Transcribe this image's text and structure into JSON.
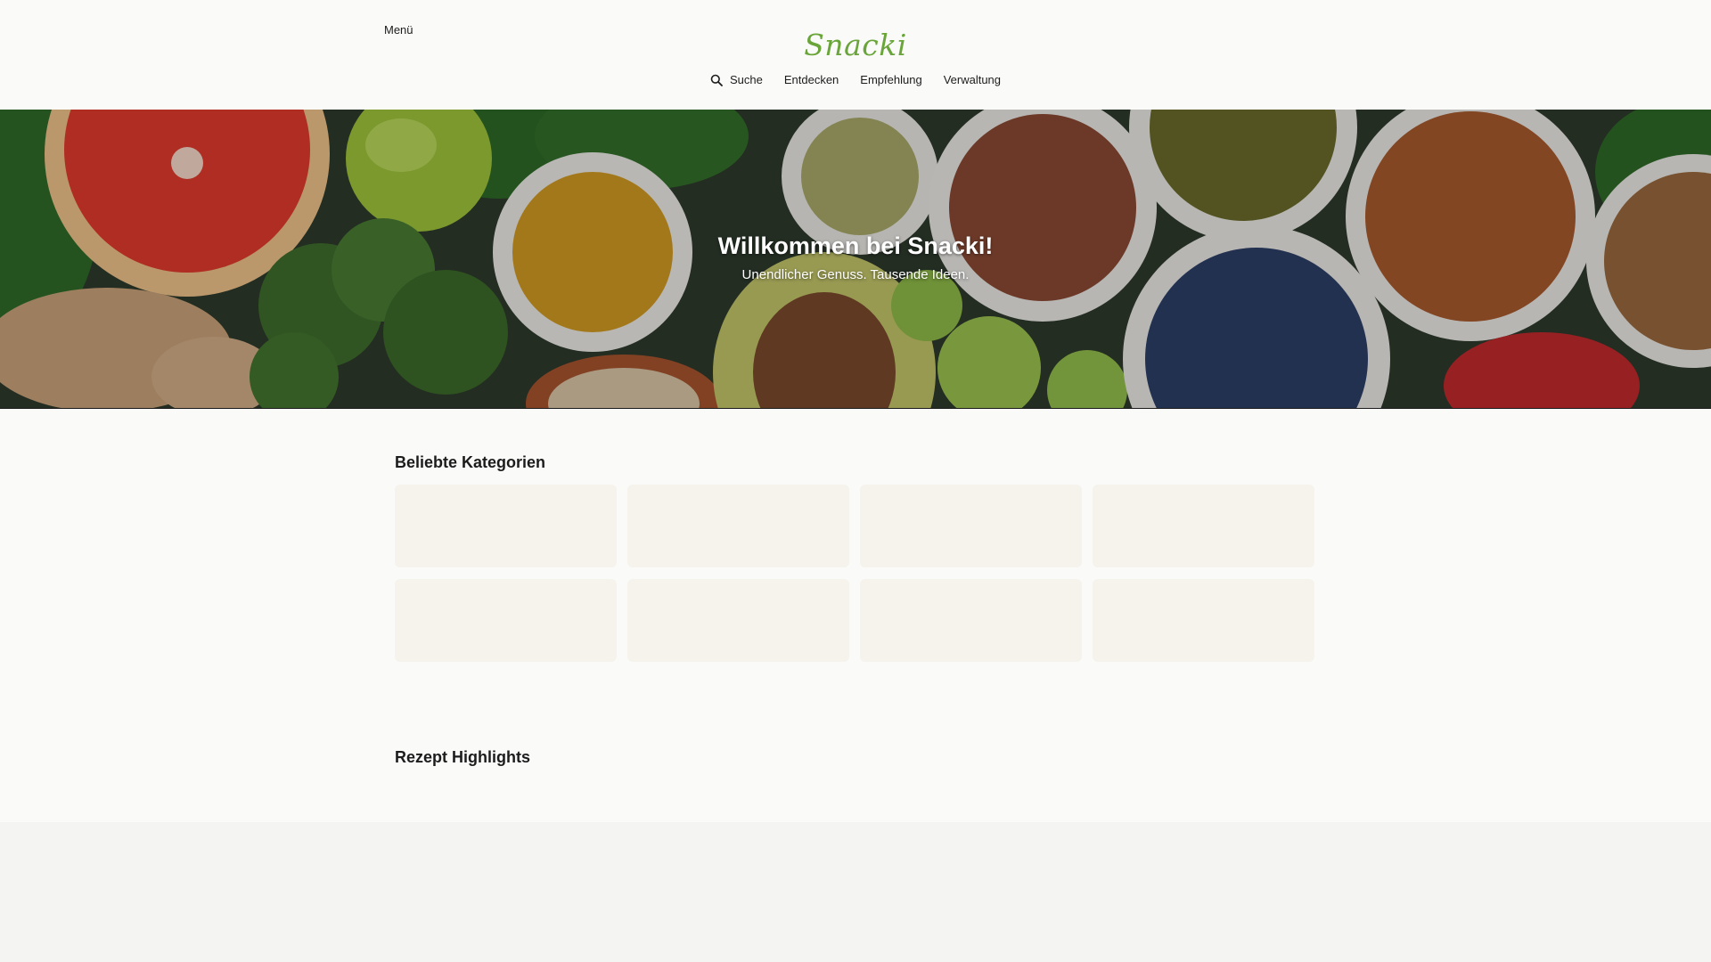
{
  "header": {
    "menu_label": "Menü",
    "brand": "Snacki",
    "brand_color": "#6aa53a",
    "nav": [
      {
        "label": "Suche",
        "icon": "search-icon"
      },
      {
        "label": "Entdecken"
      },
      {
        "label": "Empfehlung"
      },
      {
        "label": "Verwaltung"
      }
    ]
  },
  "hero": {
    "title": "Willkommen bei Snacki!",
    "subtitle": "Unendlicher Genuss. Tausende Ideen."
  },
  "categories": {
    "title": "Beliebte Kategorien",
    "card_color": "#f6f3ec",
    "cards": [
      "",
      "",
      "",
      "",
      "",
      "",
      "",
      ""
    ]
  },
  "highlights": {
    "title": "Rezept Highlights"
  }
}
